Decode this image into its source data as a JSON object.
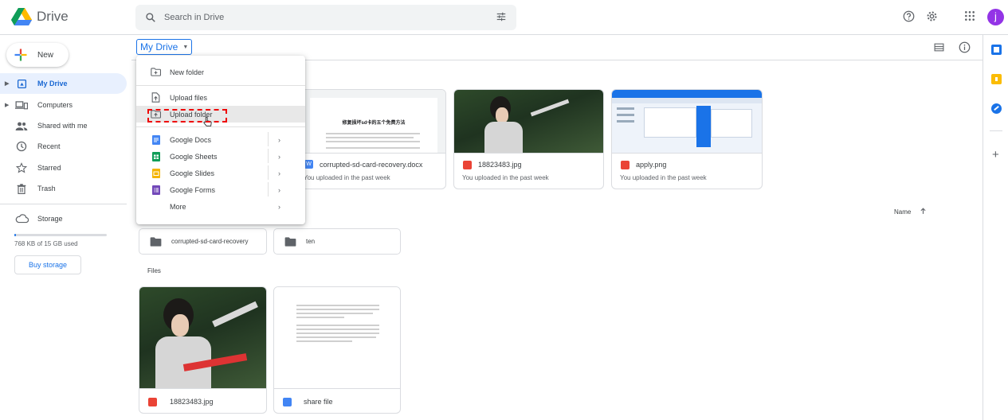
{
  "app": {
    "name": "Drive",
    "search_placeholder": "Search in Drive",
    "avatar_letter": "j"
  },
  "icons": {
    "search": "search-icon",
    "tune": "tune-icon",
    "help": "help-icon",
    "settings": "gear-icon",
    "apps": "apps-grid-icon",
    "list_view": "list-view-icon",
    "info": "info-icon"
  },
  "colors": {
    "accent": "#1a73e8",
    "avatar": "#9334e6",
    "active_nav_bg": "#e8f0fe",
    "highlight": "#e00000"
  },
  "sidebar": {
    "new_label": "New",
    "items": [
      {
        "label": "My Drive",
        "active": true
      },
      {
        "label": "Computers"
      },
      {
        "label": "Shared with me"
      },
      {
        "label": "Recent"
      },
      {
        "label": "Starred"
      },
      {
        "label": "Trash"
      },
      {
        "label": "Storage"
      }
    ],
    "storage_used_text": "768 KB of 15 GB used",
    "storage_used_fraction": 0.02,
    "buy_storage": "Buy storage"
  },
  "breadcrumb": {
    "label": "My Drive"
  },
  "menu": {
    "new_folder": "New folder",
    "upload_files": "Upload files",
    "upload_folder": "Upload folder",
    "google_docs": "Google Docs",
    "google_sheets": "Google Sheets",
    "google_slides": "Google Slides",
    "google_forms": "Google Forms",
    "more": "More"
  },
  "suggested": [
    {
      "name": "corrupted-sd-card-recovery.docx",
      "sub": "You uploaded in the past week",
      "doc_title": "修复损坏sd卡的五个免费方法"
    },
    {
      "name": "18823483.jpg",
      "sub": "You uploaded in the past week"
    },
    {
      "name": "apply.png",
      "sub": "You uploaded in the past week"
    }
  ],
  "sort": {
    "label": "Name"
  },
  "folders": [
    {
      "name": "corrupted-sd-card-recovery"
    },
    {
      "name": "ten"
    }
  ],
  "files_label": "Files",
  "files": [
    {
      "name": "18823483.jpg"
    },
    {
      "name": "share file"
    }
  ]
}
